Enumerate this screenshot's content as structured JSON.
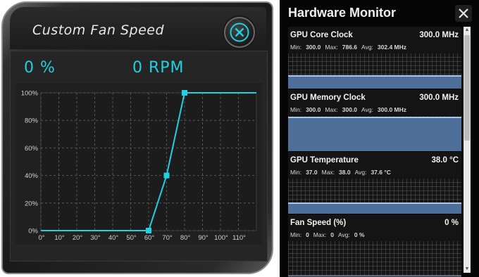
{
  "fan_panel": {
    "title": "Custom Fan Speed",
    "fan_percent": "0 %",
    "fan_rpm": "0 RPM",
    "accent_color": "#22d0e0"
  },
  "chart_data": {
    "type": "line",
    "x": [
      0,
      60,
      70,
      80,
      120
    ],
    "values": [
      0,
      0,
      40,
      100,
      100
    ],
    "control_points": [
      [
        60,
        0
      ],
      [
        70,
        40
      ],
      [
        80,
        100
      ]
    ],
    "x_ticks": [
      "0°",
      "10°",
      "20°",
      "30°",
      "40°",
      "50°",
      "60°",
      "70°",
      "80°",
      "90°",
      "100°",
      "110°"
    ],
    "y_ticks": [
      "0%",
      "20%",
      "40%",
      "60%",
      "80%",
      "100%"
    ],
    "xlim": [
      0,
      120
    ],
    "ylim": [
      0,
      100
    ],
    "grid": true
  },
  "hw_monitor": {
    "title": "Hardware Monitor",
    "items": [
      {
        "label": "GPU Core Clock",
        "value": "300.0 MHz",
        "min_label": "Min:",
        "min": "300.0",
        "max_label": "Max:",
        "max": "786.6",
        "avg_label": "Avg:",
        "avg": "302.4 MHz",
        "level": 0.38
      },
      {
        "label": "GPU Memory Clock",
        "value": "300.0 MHz",
        "min_label": "Min:",
        "min": "300.0",
        "max_label": "Max:",
        "max": "300.0",
        "avg_label": "Avg:",
        "avg": "300.0 MHz",
        "level": 0.98
      },
      {
        "label": "GPU Temperature",
        "value": "38.0 °C",
        "min_label": "Min:",
        "min": "37.0",
        "max_label": "Max:",
        "max": "38.0",
        "avg_label": "Avg:",
        "avg": "37.6 °C",
        "level": 0.32
      },
      {
        "label": "Fan Speed (%)",
        "value": "0 %",
        "min_label": "Min:",
        "min": "0",
        "max_label": "Max:",
        "max": "0",
        "avg_label": "Avg:",
        "avg": "0 %",
        "level": 0.0
      }
    ],
    "graph_fill_color": "#4e6f99",
    "graph_line_color": "#a9c8ea"
  }
}
